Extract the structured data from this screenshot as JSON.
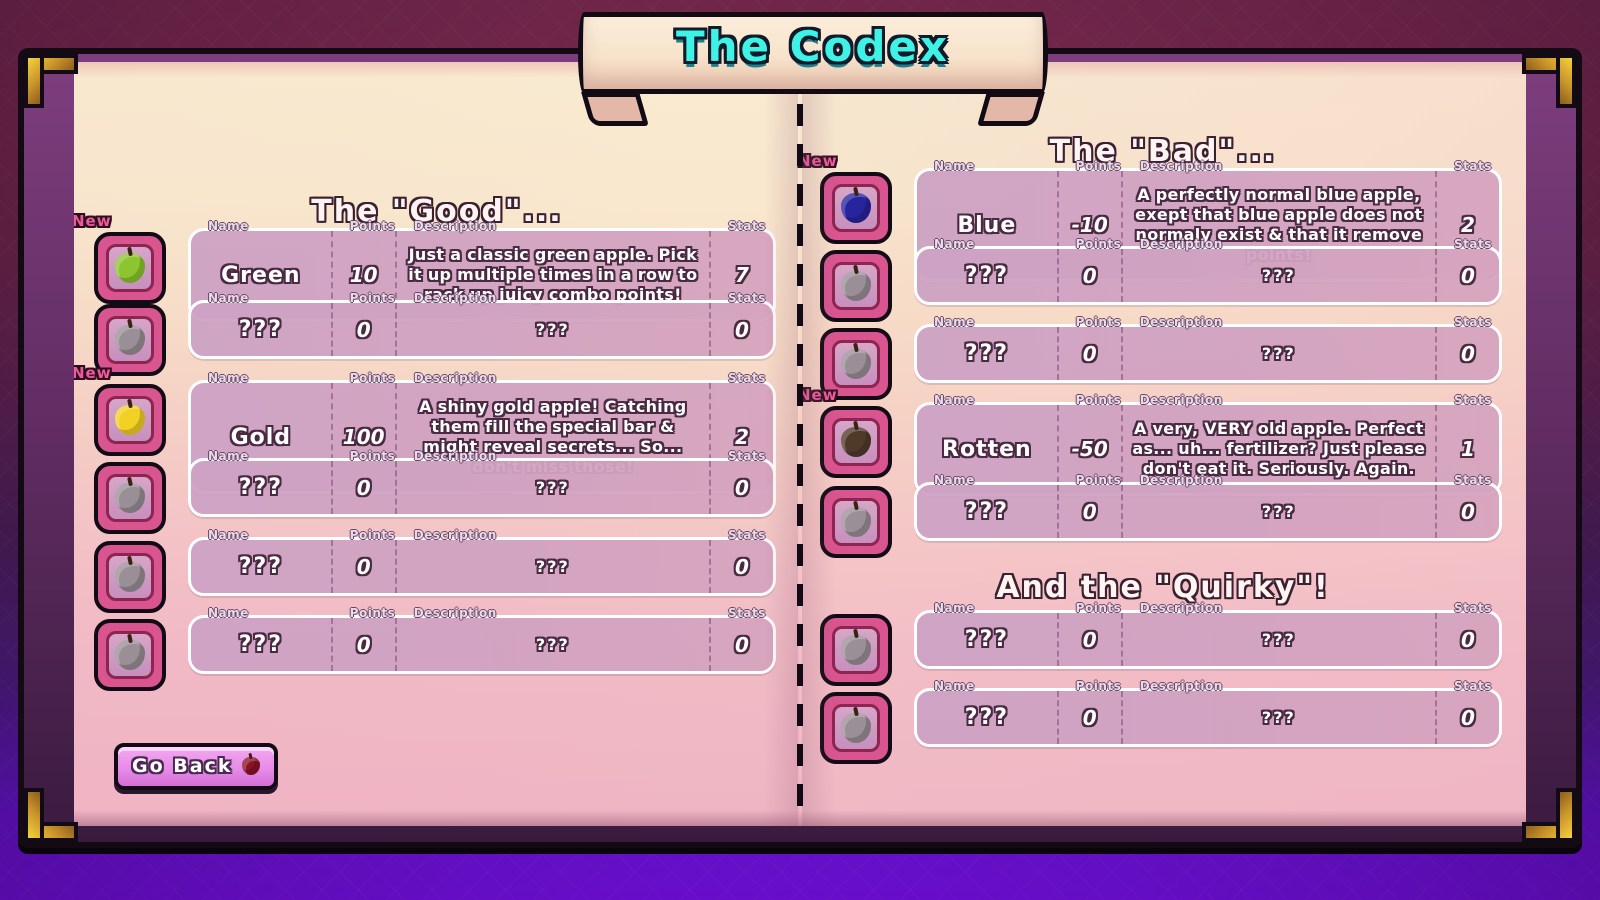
{
  "window": {
    "title": "The Codex"
  },
  "columns": {
    "name": "Name",
    "points": "Points",
    "description": "Description",
    "stats": "Stats"
  },
  "badges": {
    "new": "New"
  },
  "colors": {
    "title_cyan": "#3ef2e6",
    "new_badge_pink": "#f05a9b",
    "row_fill": "#cda2c4",
    "page_cream": "#f6e8cf",
    "page_pink": "#ecb2c2",
    "button_pink": "#e78ce8",
    "background_maroon": "#7a2a4e",
    "background_violet": "#7a10f0"
  },
  "left_page": {
    "heading": "The \"Good\"...",
    "entries": [
      {
        "is_new": true,
        "icon": "green-apple-icon",
        "icon_color": "#8cc52f",
        "name": "Green",
        "points": "10",
        "description": "Just a classic green apple. Pick it up multiple times in a row to rack up juicy combo points!",
        "stats": "7",
        "locked": false
      },
      {
        "is_new": false,
        "icon": "locked-apple-icon",
        "icon_color": "#9a8f96",
        "name": "???",
        "points": "0",
        "description": "???",
        "stats": "0",
        "locked": true
      },
      {
        "is_new": true,
        "icon": "gold-apple-icon",
        "icon_color": "#f2d024",
        "name": "Gold",
        "points": "100",
        "description": "A shiny gold apple! Catching them fill the special bar & might reveal secrets... So... don't miss those!",
        "stats": "2",
        "locked": false
      },
      {
        "is_new": false,
        "icon": "locked-apple-icon",
        "icon_color": "#9a8f96",
        "name": "???",
        "points": "0",
        "description": "???",
        "stats": "0",
        "locked": true
      },
      {
        "is_new": false,
        "icon": "locked-apple-icon",
        "icon_color": "#9a8f96",
        "name": "???",
        "points": "0",
        "description": "???",
        "stats": "0",
        "locked": true
      },
      {
        "is_new": false,
        "icon": "locked-apple-icon",
        "icon_color": "#9a8f96",
        "name": "???",
        "points": "0",
        "description": "???",
        "stats": "0",
        "locked": true
      }
    ]
  },
  "right_page": {
    "heading_bad": "The \"Bad\"...",
    "heading_quirky": "And the \"Quirky\"!",
    "bad_entries": [
      {
        "is_new": true,
        "icon": "blue-apple-icon",
        "icon_color": "#27249e",
        "name": "Blue",
        "points": "-10",
        "description": "A perfectly normal blue apple, exept that blue apple does not normaly exist & that it remove points!",
        "stats": "2",
        "locked": false
      },
      {
        "is_new": false,
        "icon": "locked-apple-icon",
        "icon_color": "#9a8f96",
        "name": "???",
        "points": "0",
        "description": "???",
        "stats": "0",
        "locked": true
      },
      {
        "is_new": false,
        "icon": "locked-apple-icon",
        "icon_color": "#9a8f96",
        "name": "???",
        "points": "0",
        "description": "???",
        "stats": "0",
        "locked": true
      },
      {
        "is_new": true,
        "icon": "rotten-apple-icon",
        "icon_color": "#4f3a2a",
        "name": "Rotten",
        "points": "-50",
        "description": "A very, VERY old apple. Perfect as... uh... fertilizer? Just please don't eat it. Seriously. Again.",
        "stats": "1",
        "locked": false
      },
      {
        "is_new": false,
        "icon": "locked-apple-icon",
        "icon_color": "#9a8f96",
        "name": "???",
        "points": "0",
        "description": "???",
        "stats": "0",
        "locked": true
      }
    ],
    "quirky_entries": [
      {
        "is_new": false,
        "icon": "locked-apple-icon",
        "icon_color": "#9a8f96",
        "name": "???",
        "points": "0",
        "description": "???",
        "stats": "0",
        "locked": true
      },
      {
        "is_new": false,
        "icon": "locked-apple-icon",
        "icon_color": "#9a8f96",
        "name": "???",
        "points": "0",
        "description": "???",
        "stats": "0",
        "locked": true
      }
    ]
  },
  "footer": {
    "go_back_label": "Go Back",
    "go_back_icon": "red-apple-icon"
  }
}
